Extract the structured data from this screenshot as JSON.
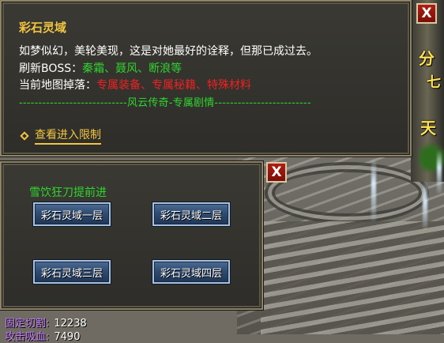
{
  "main_panel": {
    "title": "彩石灵域",
    "description": "如梦似幻，美轮美现，这是对她最好的诠释，但那已成过去。",
    "boss_label": "刷新BOSS：",
    "boss_names": "秦霜、聂风、断浪等",
    "drop_label": "当前地图掉落：",
    "drop_items": "专属装备、专属秘籍、特殊材料",
    "divider": "----------------------------风云传奇-专属剧情-------------------------",
    "restrict_link": "查看进入限制",
    "close_label": "X"
  },
  "zone_panel": {
    "subtitle": "雪饮狂刀提前进",
    "zones": [
      "彩石灵域一层",
      "彩石灵域二层",
      "彩石灵域三层",
      "彩石灵域四层"
    ],
    "close_label": "X"
  },
  "background_sign": [
    "分",
    "七",
    "天"
  ],
  "stats": {
    "line1_label": "固定切割:",
    "line1_value": "12238",
    "line2_label": "攻击吸血:",
    "line2_value": "7490"
  },
  "colors": {
    "title": "#f2c541",
    "green_text": "#2fd52f",
    "red_text": "#ee2222",
    "stat_label": "#c67cff",
    "button_blue": "#2f4c72",
    "close_red": "#b01d12"
  }
}
